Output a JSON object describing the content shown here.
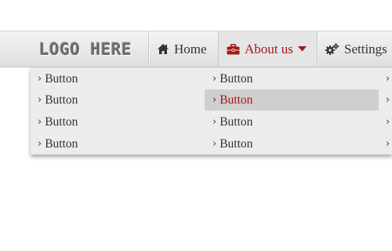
{
  "logo": {
    "text": "LOGO HERE"
  },
  "nav": {
    "items": [
      {
        "label": "Home",
        "icon": "home-icon"
      },
      {
        "label": "About us",
        "icon": "briefcase-icon",
        "caret": "caret-down-icon",
        "active": true
      },
      {
        "label": "Settings",
        "icon": "gears-icon"
      }
    ]
  },
  "dropdown": {
    "chevron": "›",
    "col1": [
      "Button",
      "Button",
      "Button",
      "Button"
    ],
    "col2": [
      "Button",
      "Button",
      "Button",
      "Button"
    ],
    "col3_chevrons": [
      "›",
      "›",
      "›",
      "›"
    ],
    "highlighted": {
      "column": 2,
      "row": 2
    }
  },
  "colors": {
    "accent": "#a31818",
    "bar": "#e2e2e2",
    "menu_bg": "#ececec",
    "menu_hover": "#cfcfcf",
    "text": "#333333"
  }
}
